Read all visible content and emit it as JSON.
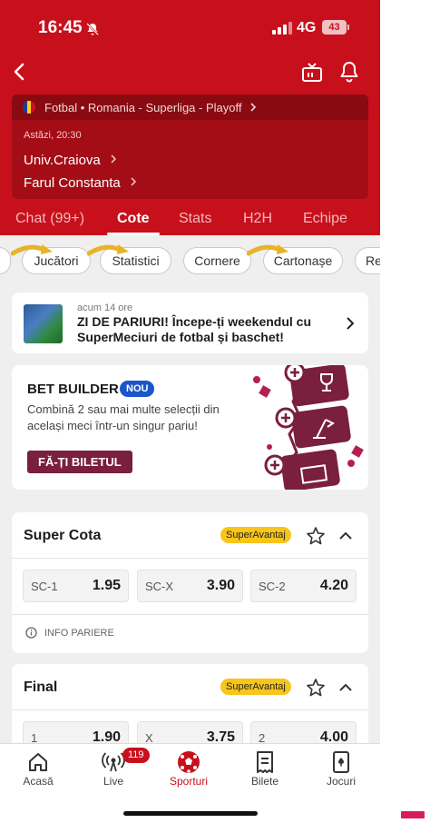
{
  "status_bar": {
    "time": "16:45",
    "network": "4G",
    "battery": "43"
  },
  "match": {
    "breadcrumb": "Fotbal • Romania - Superliga - Playoff",
    "time": "Astăzi, 20:30",
    "home_team": "Univ.Craiova",
    "away_team": "Farul Constanta"
  },
  "tabs": [
    "Chat (99+)",
    "Cote",
    "Stats",
    "H2H",
    "Echipe"
  ],
  "active_tab": "Cote",
  "chips": [
    "Jucători",
    "Statistici",
    "Cornere",
    "Cartonașe",
    "Re"
  ],
  "news": {
    "meta": "acum 14 ore",
    "title": "ZI DE PARIURI! Începe-ți weekendul cu SuperMeciuri de fotbal și baschet!"
  },
  "bet_builder": {
    "title": "BET BUILDER",
    "badge": "NOU",
    "description": "Combină 2 sau mai multe selecții din același meci într-un singur pariu!",
    "cta": "FĂ-ȚI BILETUL"
  },
  "markets": [
    {
      "title": "Super Cota",
      "pill": "SuperAvantaj",
      "odds": [
        {
          "label": "SC-1",
          "value": "1.95"
        },
        {
          "label": "SC-X",
          "value": "3.90"
        },
        {
          "label": "SC-2",
          "value": "4.20"
        }
      ],
      "info": "INFO PARIERE"
    },
    {
      "title": "Final",
      "pill": "SuperAvantaj",
      "odds": [
        {
          "label": "1",
          "value": "1.90"
        },
        {
          "label": "X",
          "value": "3.75"
        },
        {
          "label": "2",
          "value": "4.00"
        }
      ]
    }
  ],
  "bottom_nav": {
    "items": [
      "Acasă",
      "Live",
      "Sporturi",
      "Bilete",
      "Jocuri"
    ],
    "live_count": "119",
    "active": "Sporturi"
  },
  "colors": {
    "brand_red": "#c8101c",
    "pill_yellow": "#f7c51b",
    "bet_builder_purple": "#7a1f3d",
    "badge_blue": "#1a55c9"
  }
}
